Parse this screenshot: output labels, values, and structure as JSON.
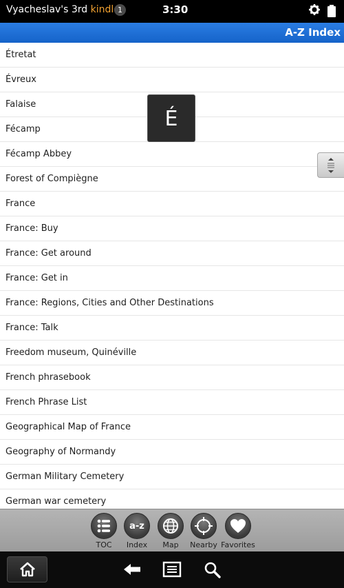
{
  "status_bar": {
    "device_name": "Vyacheslav's 3rd ",
    "brand": "kindle",
    "notification_count": "1",
    "time": "3:30"
  },
  "title_bar": {
    "title": "A-Z Index"
  },
  "fast_scroll_letter": "É",
  "list": {
    "items": [
      "Étretat",
      "Évreux",
      "Falaise",
      "Fécamp",
      "Fécamp Abbey",
      "Forest of Compiègne",
      "France",
      "France: Buy",
      "France: Get around",
      "France: Get in",
      "France: Regions, Cities and Other Destinations",
      "France: Talk",
      "Freedom museum, Quinéville",
      "French phrasebook",
      "French Phrase List",
      "Geographical Map of France",
      "Geography of Normandy",
      "German Military Cemetery",
      "German war cemetery"
    ]
  },
  "toolbar": {
    "toc_label": "TOC",
    "index_icon_text": "a-z",
    "index_label": "Index",
    "map_label": "Map",
    "nearby_label": "Nearby",
    "favorites_label": "Favorites"
  },
  "colors": {
    "title_bar": "#1a6fd6",
    "kindle_brand": "#f0a030",
    "status_bar": "#000000",
    "toolbar": "#a8a8a8"
  }
}
